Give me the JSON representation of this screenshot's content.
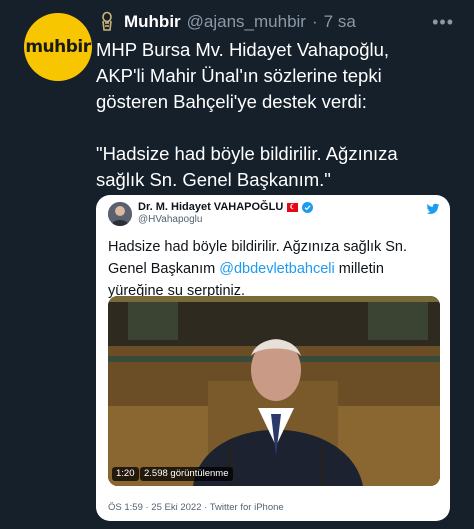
{
  "tweet": {
    "avatar_text": "muhbir",
    "author_name": "Muhbir",
    "handle": "@ajans_muhbir",
    "separator": "·",
    "time": "7 sa",
    "text": "MHP Bursa Mv. Hidayet Vahapoğlu,\nAKP'li Mahir Ünal'ın sözlerine tepki\ngösteren Bahçeli'ye destek verdi:\n\n\"Hadsize had böyle bildirilir. Ağzınıza\nsağlık Sn. Genel Başkanım.\"",
    "more_icon": "more-horizontal-icon",
    "verified_icon": "gold-verified-badge-icon"
  },
  "quote": {
    "author_name": "Dr. M. Hidayet VAHAPOĞLU",
    "handle": "@HVahapoglu",
    "flag_icon": "turkey-flag-icon",
    "verified_icon": "blue-verified-badge-icon",
    "twitter_icon": "twitter-bird-icon",
    "text_before_mention": "Hadsize had böyle bildirilir. Ağzınıza sağlık Sn. Genel Başkanım",
    "mention": "@dbdevletbahceli",
    "text_after_mention": " milletin yüreğine su serptiniz.",
    "video": {
      "duration": "1:20",
      "views": "2.598 görüntülenme"
    },
    "footer": "ÖS 1:59 · 25 Eki 2022 · Twitter for iPhone"
  },
  "colors": {
    "background": "#15202b",
    "muted": "#8b98a5",
    "link": "#1d9bf0",
    "avatar_yellow": "#f7c600"
  }
}
